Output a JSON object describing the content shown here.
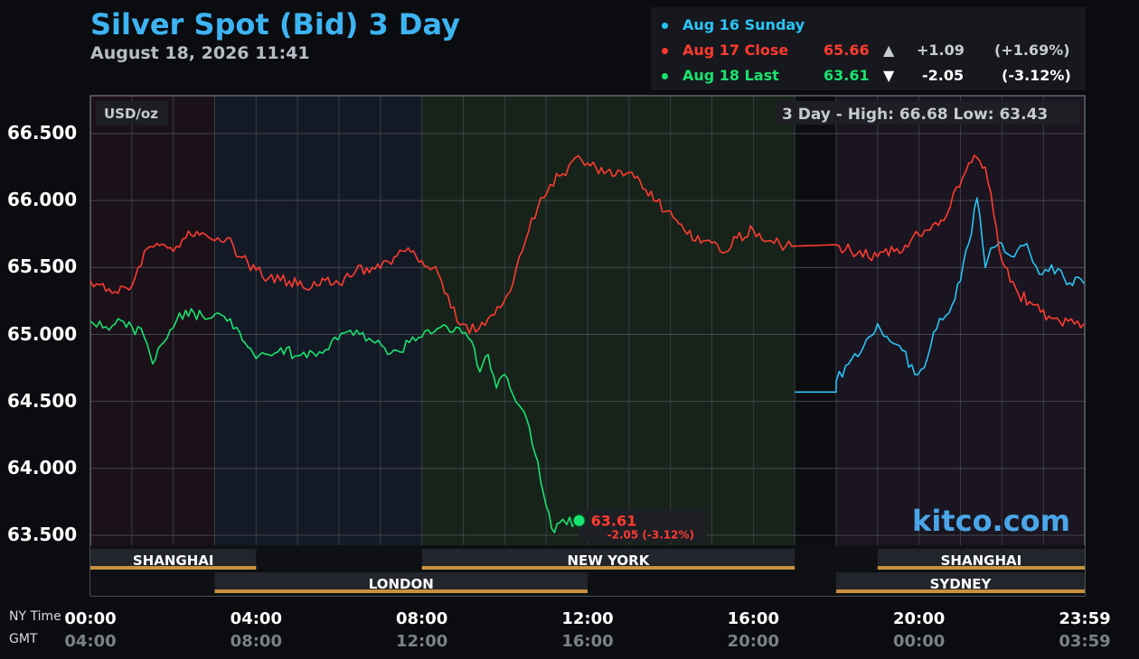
{
  "header": {
    "title": "Silver Spot (Bid) 3 Day",
    "datetime": "August 18, 2026 11:41"
  },
  "legend": {
    "rows": [
      {
        "label": "Aug 16 Sunday",
        "color": "#29c4f6",
        "value": "",
        "arrow": "",
        "change": "",
        "pct": ""
      },
      {
        "label": "Aug 17 Close",
        "color": "#ff3b2f",
        "value": "65.66",
        "arrow": "▲",
        "change": "+1.09",
        "pct": "(+1.69%)"
      },
      {
        "label": "Aug 18 Last",
        "color": "#19e36f",
        "value": "63.61",
        "arrow": "▼",
        "change": "-2.05",
        "pct": "(-3.12%)"
      }
    ]
  },
  "chart": {
    "unit_label": "USD/oz",
    "highlow": "3 Day - High: 66.68  Low: 63.43",
    "watermark": "kitco.com",
    "last_value": "63.61",
    "last_change": "-2.05 (-3.12%)",
    "y_labels": [
      "66.500",
      "66.000",
      "65.500",
      "65.000",
      "64.500",
      "64.000",
      "63.500"
    ],
    "x_labels_ny": [
      "00:00",
      "04:00",
      "08:00",
      "12:00",
      "16:00",
      "20:00",
      "23:59"
    ],
    "x_labels_gmt": [
      "04:00",
      "08:00",
      "12:00",
      "16:00",
      "20:00",
      "00:00",
      "03:59"
    ],
    "ny_time_label": "NY Time",
    "gmt_label": "GMT",
    "sessions": [
      {
        "name": "SHANGHAI",
        "start": 0,
        "end": 4,
        "row": 1
      },
      {
        "name": "NEW YORK",
        "start": 8,
        "end": 17,
        "row": 1
      },
      {
        "name": "SHANGHAI",
        "start": 19,
        "end": 24,
        "row": 1
      },
      {
        "name": "LONDON",
        "start": 3,
        "end": 12,
        "row": 2
      },
      {
        "name": "SYDNEY",
        "start": 18,
        "end": 24,
        "row": 2
      }
    ]
  },
  "chart_data": {
    "type": "line",
    "title": "Silver Spot (Bid) 3 Day",
    "ylabel": "USD/oz",
    "xlabel": "NY Time",
    "x_ticks": [
      "00:00",
      "04:00",
      "08:00",
      "12:00",
      "16:00",
      "20:00",
      "23:59"
    ],
    "ylim": [
      63.4,
      66.7
    ],
    "grid": true,
    "series": [
      {
        "name": "Aug 16 Sunday",
        "color": "#29c4f6",
        "x": [
          17.0,
          18.0,
          18.0,
          18.3,
          18.6,
          19.0,
          19.3,
          19.6,
          19.9,
          20.2,
          20.5,
          20.8,
          21.0,
          21.2,
          21.4,
          21.6,
          21.8,
          22.0,
          22.3,
          22.6,
          22.9,
          23.2,
          23.5,
          23.98
        ],
        "y": [
          64.57,
          64.57,
          64.65,
          64.78,
          64.87,
          65.08,
          64.95,
          64.88,
          64.7,
          64.82,
          65.12,
          65.22,
          65.4,
          65.68,
          66.02,
          65.5,
          65.65,
          65.68,
          65.58,
          65.68,
          65.45,
          65.52,
          65.42,
          65.38
        ]
      },
      {
        "name": "Aug 17 Close",
        "color": "#ff3b2f",
        "x": [
          0.0,
          0.3,
          0.6,
          1.0,
          1.3,
          1.6,
          2.0,
          2.3,
          2.7,
          3.0,
          3.3,
          3.6,
          4.0,
          4.3,
          4.8,
          5.2,
          5.6,
          6.0,
          6.4,
          6.8,
          7.2,
          7.6,
          8.0,
          8.4,
          8.7,
          9.0,
          9.3,
          9.6,
          9.9,
          10.2,
          10.5,
          10.8,
          11.1,
          11.4,
          11.7,
          12.0,
          12.4,
          12.8,
          13.2,
          13.6,
          14.0,
          14.4,
          14.8,
          15.2,
          15.6,
          16.0,
          16.5,
          17.0,
          18.0,
          18.5,
          19.0,
          19.4,
          19.8,
          20.2,
          20.6,
          20.9,
          21.2,
          21.4,
          21.6,
          21.8,
          22.0,
          22.4,
          22.8,
          23.2,
          23.6,
          23.98
        ],
        "y": [
          65.4,
          65.38,
          65.32,
          65.36,
          65.62,
          65.68,
          65.62,
          65.72,
          65.76,
          65.7,
          65.72,
          65.58,
          65.48,
          65.42,
          65.4,
          65.34,
          65.42,
          65.38,
          65.47,
          65.5,
          65.54,
          65.62,
          65.55,
          65.45,
          65.2,
          65.08,
          65.02,
          65.12,
          65.2,
          65.38,
          65.7,
          65.95,
          66.12,
          66.2,
          66.32,
          66.28,
          66.2,
          66.22,
          66.18,
          66.0,
          65.92,
          65.75,
          65.7,
          65.62,
          65.72,
          65.78,
          65.68,
          65.66,
          65.67,
          65.6,
          65.58,
          65.62,
          65.7,
          65.78,
          65.85,
          66.1,
          66.28,
          66.32,
          66.25,
          65.9,
          65.55,
          65.3,
          65.22,
          65.12,
          65.1,
          65.08
        ]
      },
      {
        "name": "Aug 18 Last",
        "color": "#19e36f",
        "x": [
          0.0,
          0.3,
          0.6,
          1.0,
          1.3,
          1.5,
          1.7,
          2.0,
          2.3,
          2.7,
          3.0,
          3.3,
          3.6,
          4.0,
          4.3,
          4.6,
          5.0,
          5.3,
          5.6,
          5.9,
          6.2,
          6.5,
          6.8,
          7.1,
          7.4,
          7.7,
          8.0,
          8.3,
          8.6,
          8.9,
          9.2,
          9.4,
          9.6,
          9.8,
          10.0,
          10.2,
          10.4,
          10.6,
          10.8,
          11.0,
          11.2,
          11.4,
          11.5,
          11.7,
          11.73
        ],
        "y": [
          65.1,
          65.05,
          65.08,
          65.06,
          64.98,
          64.78,
          64.92,
          65.05,
          65.18,
          65.14,
          65.15,
          65.1,
          65.02,
          64.82,
          64.85,
          64.9,
          64.84,
          64.88,
          64.86,
          64.98,
          65.02,
          65.0,
          64.95,
          64.9,
          64.88,
          64.94,
          64.98,
          65.02,
          65.06,
          65.05,
          64.95,
          64.72,
          64.85,
          64.6,
          64.7,
          64.55,
          64.45,
          64.3,
          64.05,
          63.72,
          63.52,
          63.62,
          63.58,
          63.62,
          63.61
        ]
      }
    ]
  }
}
